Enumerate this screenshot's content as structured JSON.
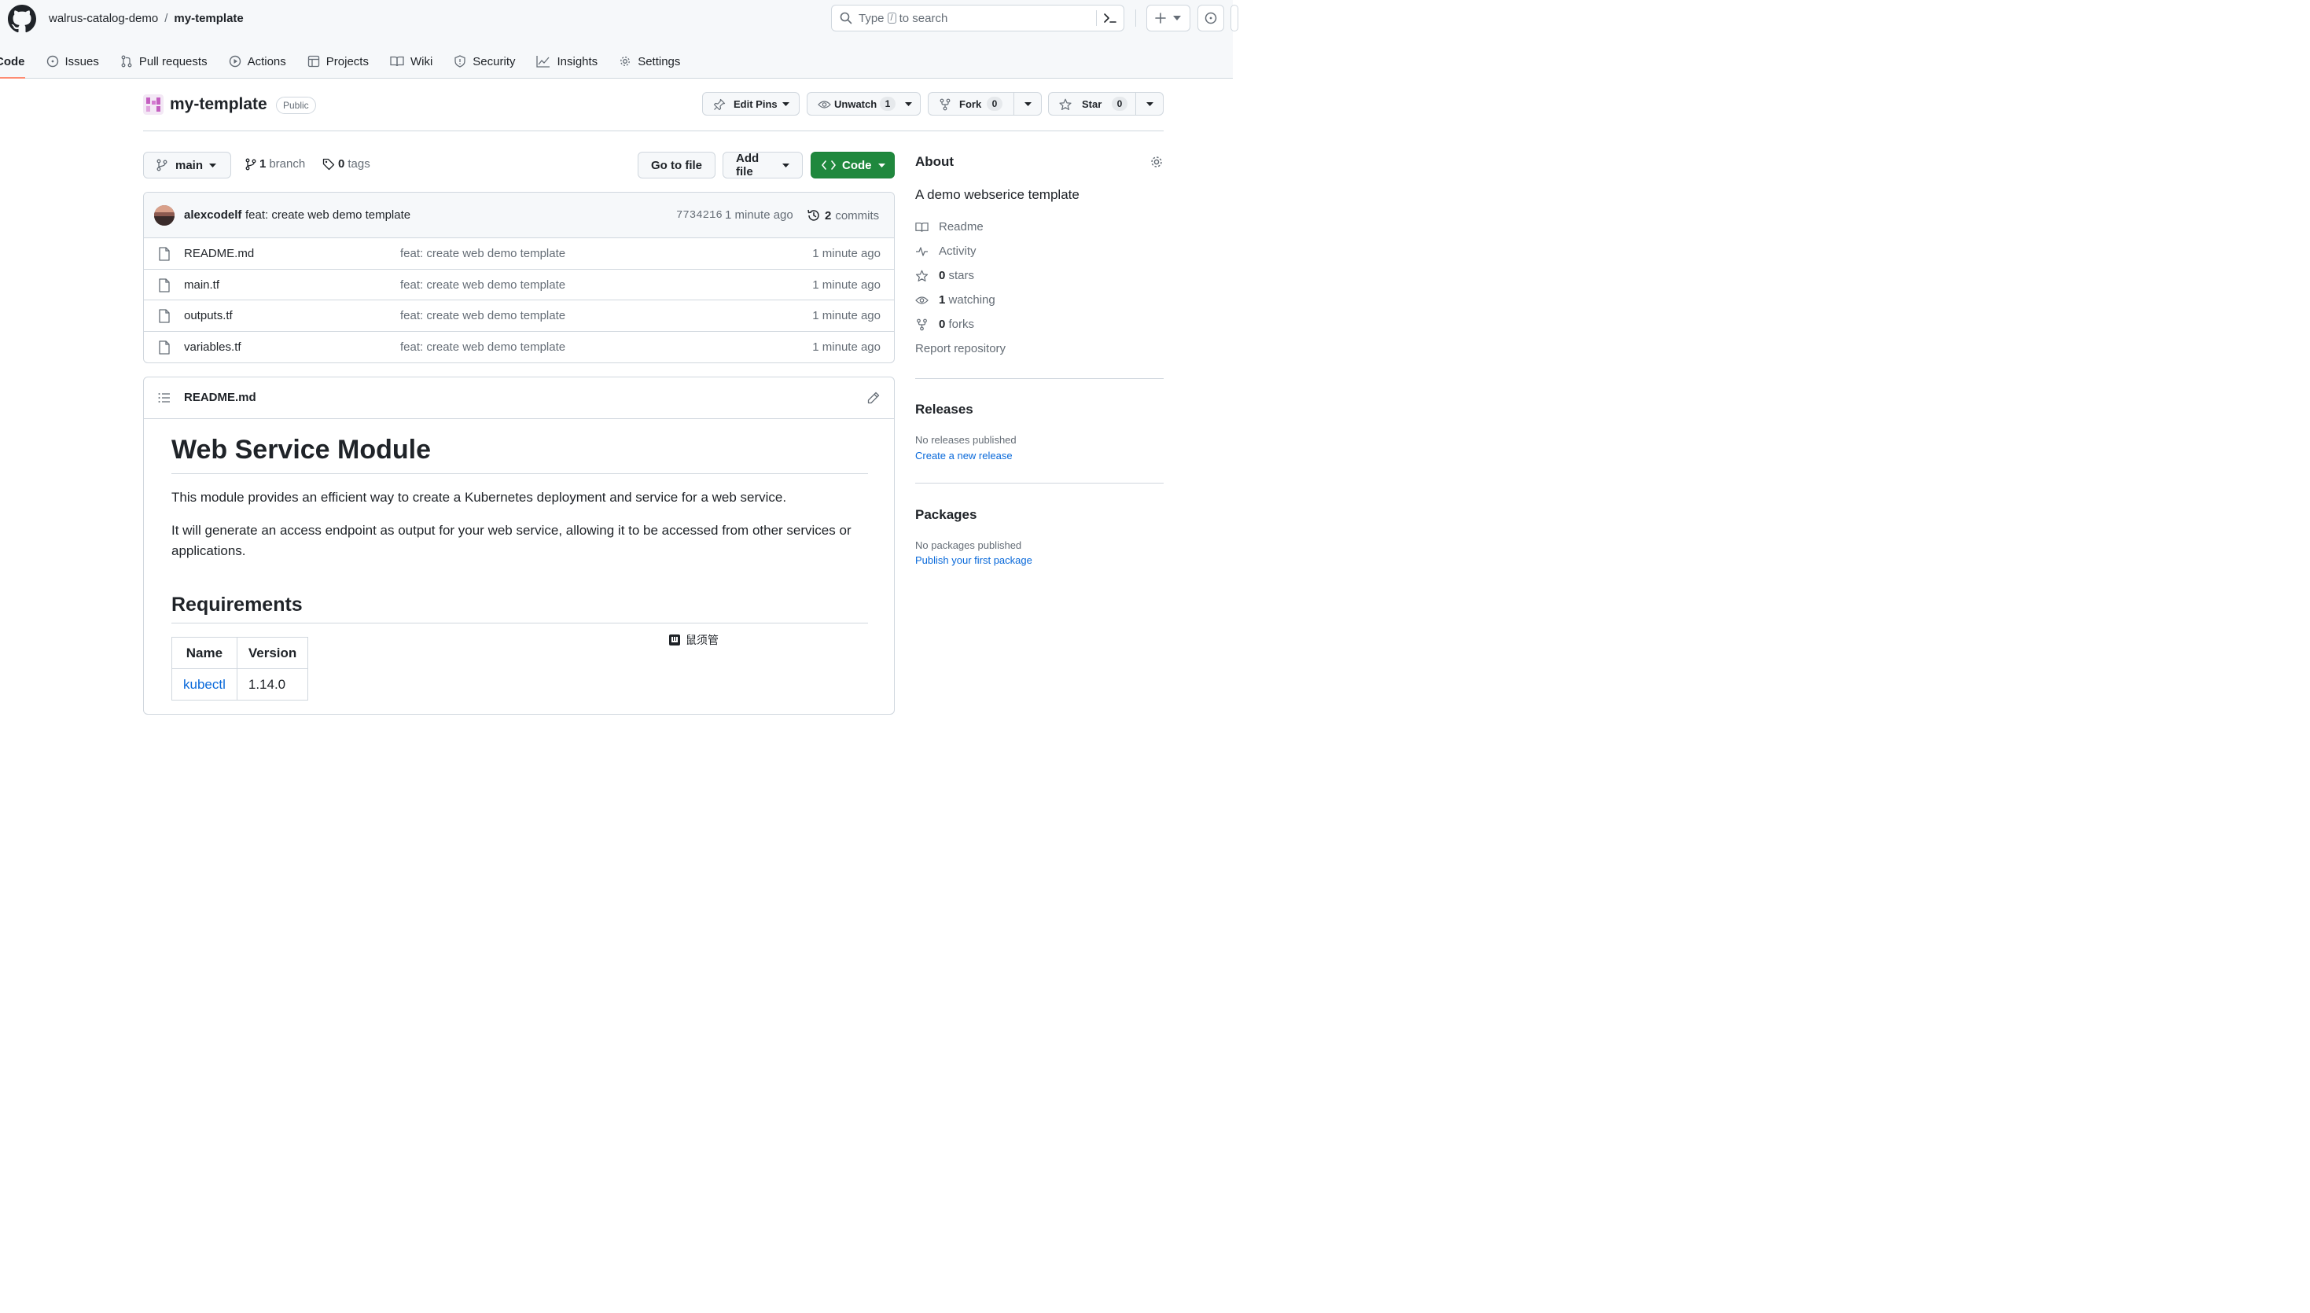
{
  "header": {
    "owner": "walrus-catalog-demo",
    "separator": "/",
    "repo": "my-template",
    "search_prefix": "Type",
    "search_key": "/",
    "search_suffix": "to search"
  },
  "nav": [
    {
      "label": "Code",
      "icon": "code-icon"
    },
    {
      "label": "Issues",
      "icon": "issue-icon"
    },
    {
      "label": "Pull requests",
      "icon": "pull-request-icon"
    },
    {
      "label": "Actions",
      "icon": "play-icon"
    },
    {
      "label": "Projects",
      "icon": "table-icon"
    },
    {
      "label": "Wiki",
      "icon": "book-icon"
    },
    {
      "label": "Security",
      "icon": "shield-icon"
    },
    {
      "label": "Insights",
      "icon": "graph-icon"
    },
    {
      "label": "Settings",
      "icon": "gear-icon"
    }
  ],
  "repo_header": {
    "title": "my-template",
    "visibility": "Public",
    "edit_pins": "Edit Pins",
    "unwatch": "Unwatch",
    "watch_count": "1",
    "fork": "Fork",
    "fork_count": "0",
    "star": "Star",
    "star_count": "0"
  },
  "file_nav": {
    "branch": "main",
    "branch_count": "1",
    "branch_label": "branch",
    "tag_count": "0",
    "tag_label": "tags",
    "go_to_file": "Go to file",
    "add_file": "Add file",
    "code": "Code"
  },
  "latest_commit": {
    "author": "alexcodelf",
    "message": "feat: create web demo template",
    "sha": "7734216",
    "time": "1 minute ago",
    "commit_count": "2",
    "commit_label": "commits"
  },
  "files": [
    {
      "name": "README.md",
      "message": "feat: create web demo template",
      "age": "1 minute ago"
    },
    {
      "name": "main.tf",
      "message": "feat: create web demo template",
      "age": "1 minute ago"
    },
    {
      "name": "outputs.tf",
      "message": "feat: create web demo template",
      "age": "1 minute ago"
    },
    {
      "name": "variables.tf",
      "message": "feat: create web demo template",
      "age": "1 minute ago"
    }
  ],
  "readme": {
    "filename": "README.md",
    "h1": "Web Service Module",
    "p1": "This module provides an efficient way to create a Kubernetes deployment and service for a web service.",
    "p2": "It will generate an access endpoint as output for your web service, allowing it to be accessed from other services or applications.",
    "h2": "Requirements",
    "table_headers": [
      "Name",
      "Version"
    ],
    "table_rows": [
      [
        "kubectl",
        "1.14.0"
      ]
    ],
    "watermark": "鼠须管"
  },
  "about": {
    "title": "About",
    "description": "A demo webserice template",
    "readme": "Readme",
    "activity": "Activity",
    "stars_count": "0",
    "stars_label": "stars",
    "watching_count": "1",
    "watching_label": "watching",
    "forks_count": "0",
    "forks_label": "forks",
    "report": "Report repository"
  },
  "releases": {
    "title": "Releases",
    "note": "No releases published",
    "link": "Create a new release"
  },
  "packages": {
    "title": "Packages",
    "note": "No packages published",
    "link": "Publish your first package"
  }
}
